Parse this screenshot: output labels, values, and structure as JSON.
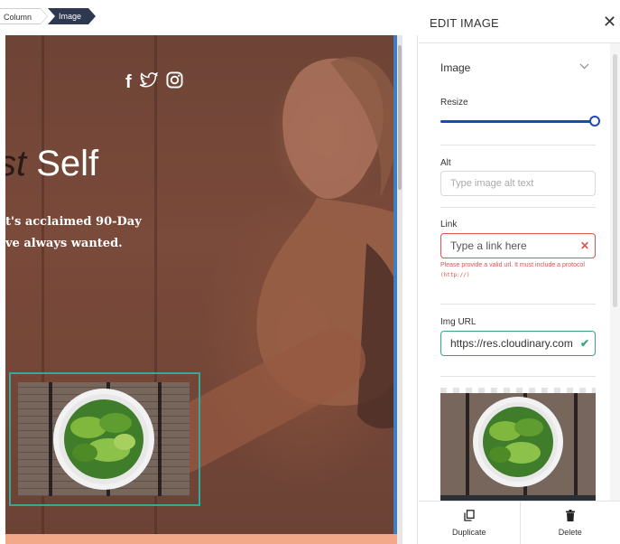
{
  "breadcrumb": {
    "items": [
      "Column",
      "Image"
    ]
  },
  "hero": {
    "social_icons": [
      "facebook-icon",
      "twitter-icon",
      "instagram-icon"
    ],
    "title_italic": "st",
    "title_rest": " Self",
    "subtitle_line1": "t's acclaimed 90-Day",
    "subtitle_line2": "ve always wanted."
  },
  "panel": {
    "title": "EDIT IMAGE",
    "section": "Image",
    "resize_label": "Resize",
    "resize_value": 1.0,
    "alt": {
      "label": "Alt",
      "placeholder": "Type image alt text"
    },
    "link": {
      "label": "Link",
      "placeholder": "Type a link here",
      "error_text": "Please provide a valid url. It must include a protocol",
      "error_code": "(http://)"
    },
    "img_url": {
      "label": "Img URL",
      "value": "https://res.cloudinary.com"
    },
    "footer": {
      "duplicate": "Duplicate",
      "delete": "Delete"
    }
  },
  "colors": {
    "accent_blue": "#1d49b8",
    "selection_green": "#36a89a",
    "error_red": "#d9534f",
    "valid_green": "#3aa876",
    "breadcrumb_active": "#2e3850"
  }
}
